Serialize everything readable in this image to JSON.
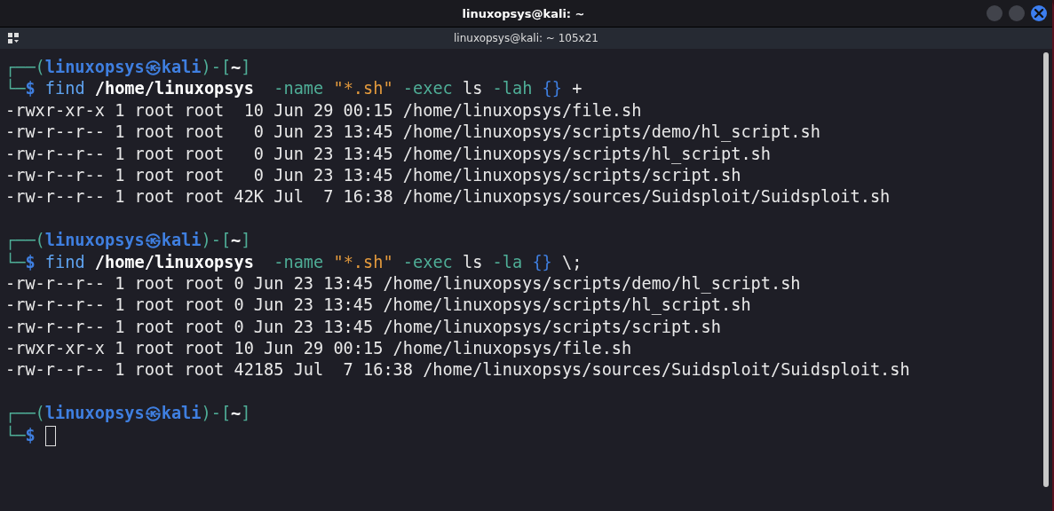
{
  "window": {
    "title": "linuxopsys@kali: ~"
  },
  "tab": {
    "title": "linuxopsys@kali: ~ 105x21"
  },
  "terminal": {
    "blocks": [
      {
        "prompt": {
          "open": "┌──(",
          "user": "linuxopsys",
          "at": "㉿",
          "host": "kali",
          "mid": ")-[",
          "dir": "~",
          "close": "]",
          "corner": "└─",
          "symbol": "$"
        },
        "command": [
          {
            "text": "find",
            "kind": "command"
          },
          {
            "text": " /home/linuxopsys",
            "kind": "path"
          },
          {
            "text": "  -name",
            "kind": "option"
          },
          {
            "text": " \"*.sh\"",
            "kind": "string"
          },
          {
            "text": " -exec",
            "kind": "option"
          },
          {
            "text": " ls",
            "kind": "plain"
          },
          {
            "text": " -lah",
            "kind": "option"
          },
          {
            "text": " {}",
            "kind": "brace"
          },
          {
            "text": " +",
            "kind": "plain"
          }
        ],
        "output": [
          "-rwxr-xr-x 1 root root  10 Jun 29 00:15 /home/linuxopsys/file.sh",
          "-rw-r--r-- 1 root root   0 Jun 23 13:45 /home/linuxopsys/scripts/demo/hl_script.sh",
          "-rw-r--r-- 1 root root   0 Jun 23 13:45 /home/linuxopsys/scripts/hl_script.sh",
          "-rw-r--r-- 1 root root   0 Jun 23 13:45 /home/linuxopsys/scripts/script.sh",
          "-rw-r--r-- 1 root root 42K Jul  7 16:38 /home/linuxopsys/sources/Suidsploit/Suidsploit.sh"
        ]
      },
      {
        "prompt": {
          "open": "┌──(",
          "user": "linuxopsys",
          "at": "㉿",
          "host": "kali",
          "mid": ")-[",
          "dir": "~",
          "close": "]",
          "corner": "└─",
          "symbol": "$"
        },
        "command": [
          {
            "text": "find",
            "kind": "command"
          },
          {
            "text": " /home/linuxopsys",
            "kind": "path"
          },
          {
            "text": "  -name",
            "kind": "option"
          },
          {
            "text": " \"*.sh\"",
            "kind": "string"
          },
          {
            "text": " -exec",
            "kind": "option"
          },
          {
            "text": " ls",
            "kind": "plain"
          },
          {
            "text": " -la",
            "kind": "option"
          },
          {
            "text": " {}",
            "kind": "brace"
          },
          {
            "text": " \\;",
            "kind": "plain"
          }
        ],
        "output": [
          "-rw-r--r-- 1 root root 0 Jun 23 13:45 /home/linuxopsys/scripts/demo/hl_script.sh",
          "-rw-r--r-- 1 root root 0 Jun 23 13:45 /home/linuxopsys/scripts/hl_script.sh",
          "-rw-r--r-- 1 root root 0 Jun 23 13:45 /home/linuxopsys/scripts/script.sh",
          "-rwxr-xr-x 1 root root 10 Jun 29 00:15 /home/linuxopsys/file.sh",
          "-rw-r--r-- 1 root root 42185 Jul  7 16:38 /home/linuxopsys/sources/Suidsploit/Suidsploit.sh"
        ]
      },
      {
        "prompt": {
          "open": "┌──(",
          "user": "linuxopsys",
          "at": "㉿",
          "host": "kali",
          "mid": ")-[",
          "dir": "~",
          "close": "]",
          "corner": "└─",
          "symbol": "$"
        },
        "cursor": true
      }
    ]
  }
}
